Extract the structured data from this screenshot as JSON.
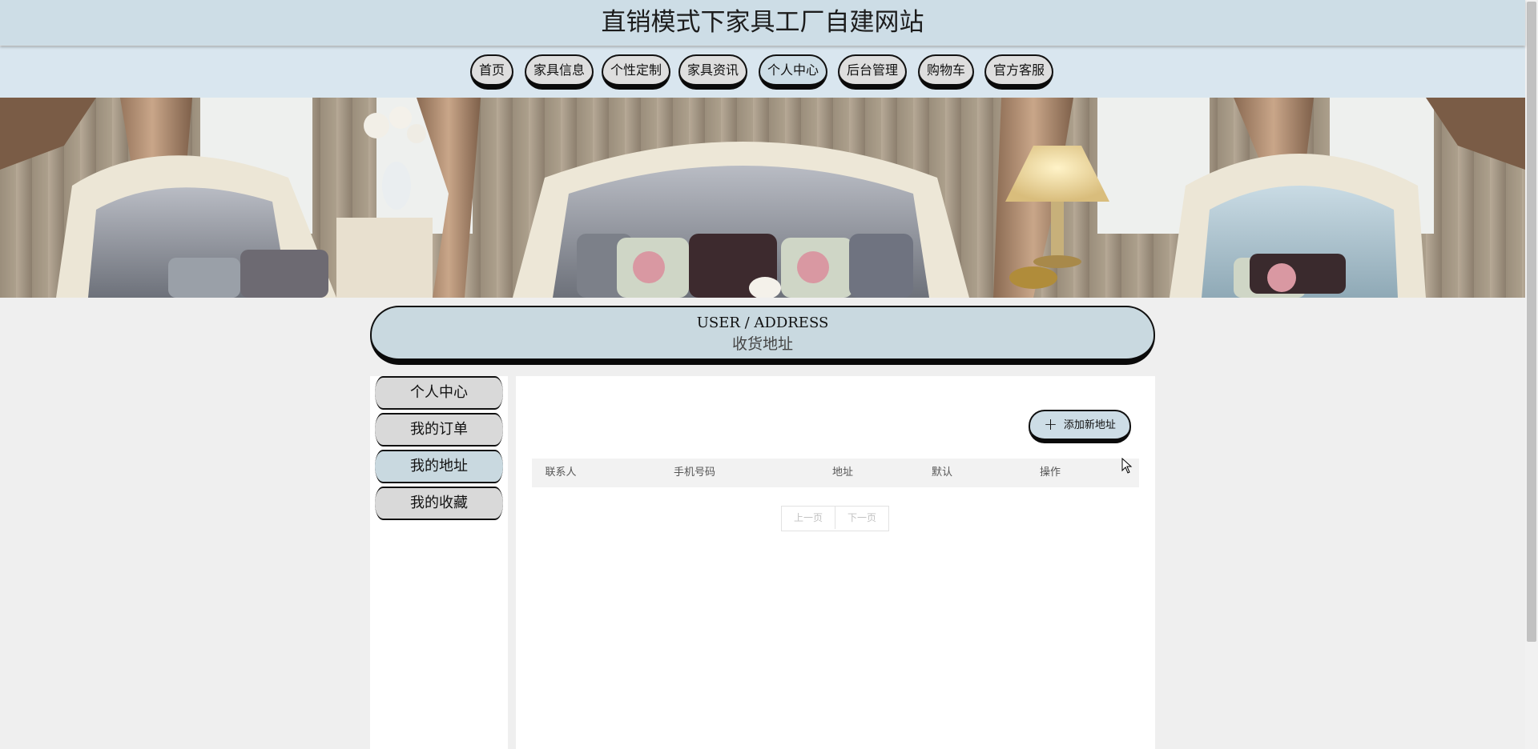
{
  "site": {
    "title": "直销模式下家具工厂自建网站"
  },
  "nav": {
    "items": [
      {
        "label": "首页"
      },
      {
        "label": "家具信息"
      },
      {
        "label": "个性定制"
      },
      {
        "label": "家具资讯"
      },
      {
        "label": "个人中心"
      },
      {
        "label": "后台管理"
      },
      {
        "label": "购物车"
      },
      {
        "label": "官方客服"
      }
    ],
    "active": "个人中心"
  },
  "section": {
    "title_en": "USER / ADDRESS",
    "title_cn": "收货地址"
  },
  "sidebar": {
    "items": [
      {
        "label": "个人中心"
      },
      {
        "label": "我的订单"
      },
      {
        "label": "我的地址"
      },
      {
        "label": "我的收藏"
      }
    ],
    "active": "我的地址"
  },
  "main": {
    "add_button": {
      "icon": "plus-icon",
      "label": "添加新地址"
    },
    "table": {
      "columns": [
        "联系人",
        "手机号码",
        "地址",
        "默认",
        "操作"
      ],
      "rows": []
    },
    "pager": {
      "prev": "上一页",
      "next": "下一页"
    }
  },
  "colors": {
    "header_bg": "#cddde6",
    "nav_bg": "#d9e6ef",
    "button_bg": "#dedede",
    "active_bg": "#c9d9e0",
    "page_bg": "#efefef"
  }
}
